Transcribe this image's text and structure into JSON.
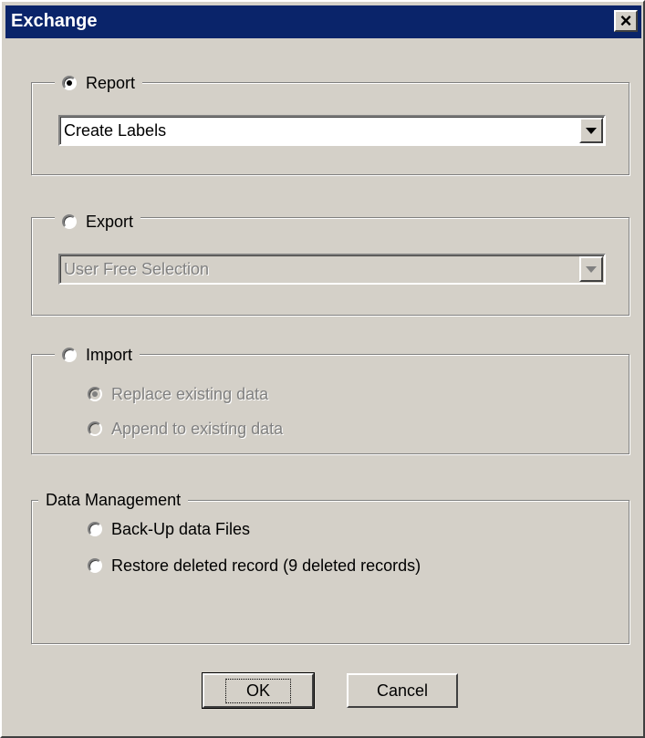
{
  "window": {
    "title": "Exchange",
    "close_symbol": "×"
  },
  "report": {
    "label": "Report",
    "selected": true,
    "combo_value": "Create Labels"
  },
  "export": {
    "label": "Export",
    "selected": false,
    "combo_value": "User Free Selection",
    "disabled": true
  },
  "import": {
    "label": "Import",
    "selected": false,
    "options": [
      {
        "label": "Replace existing data",
        "selected": true,
        "disabled": true
      },
      {
        "label": "Append to existing data",
        "selected": false,
        "disabled": true
      }
    ]
  },
  "data_management": {
    "label": "Data Management",
    "options": [
      {
        "label": "Back-Up data Files",
        "selected": false
      },
      {
        "label": "Restore deleted record (9 deleted records)",
        "selected": false
      }
    ]
  },
  "buttons": {
    "ok": "OK",
    "cancel": "Cancel"
  },
  "colors": {
    "titlebar": "#0a246a",
    "face": "#d4d0c8",
    "disabled_text": "#808080"
  }
}
